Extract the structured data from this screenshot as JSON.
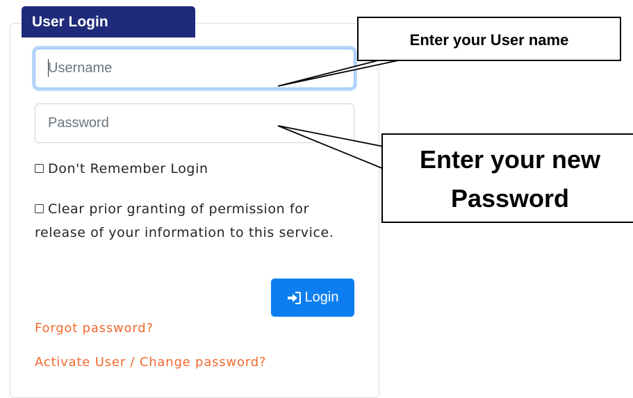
{
  "panel": {
    "title": "User Login"
  },
  "form": {
    "username_placeholder": "Username",
    "password_placeholder": "Password",
    "dont_remember_label": "Don't Remember Login",
    "clear_permission_label_line1": "Clear prior granting of permission for",
    "clear_permission_label_line2": "release of your information to this service.",
    "login_button_label": "Login",
    "login_icon": "sign-in-icon"
  },
  "links": {
    "forgot_password": "Forgot password?",
    "activate_user": "Activate User / Change password?"
  },
  "callouts": {
    "username_hint": "Enter your User name",
    "password_hint_line1": "Enter your new",
    "password_hint_line2": "Password"
  },
  "colors": {
    "title_bar": "#1f2a7a",
    "button": "#0d7ef0",
    "link": "#f06a2e"
  }
}
